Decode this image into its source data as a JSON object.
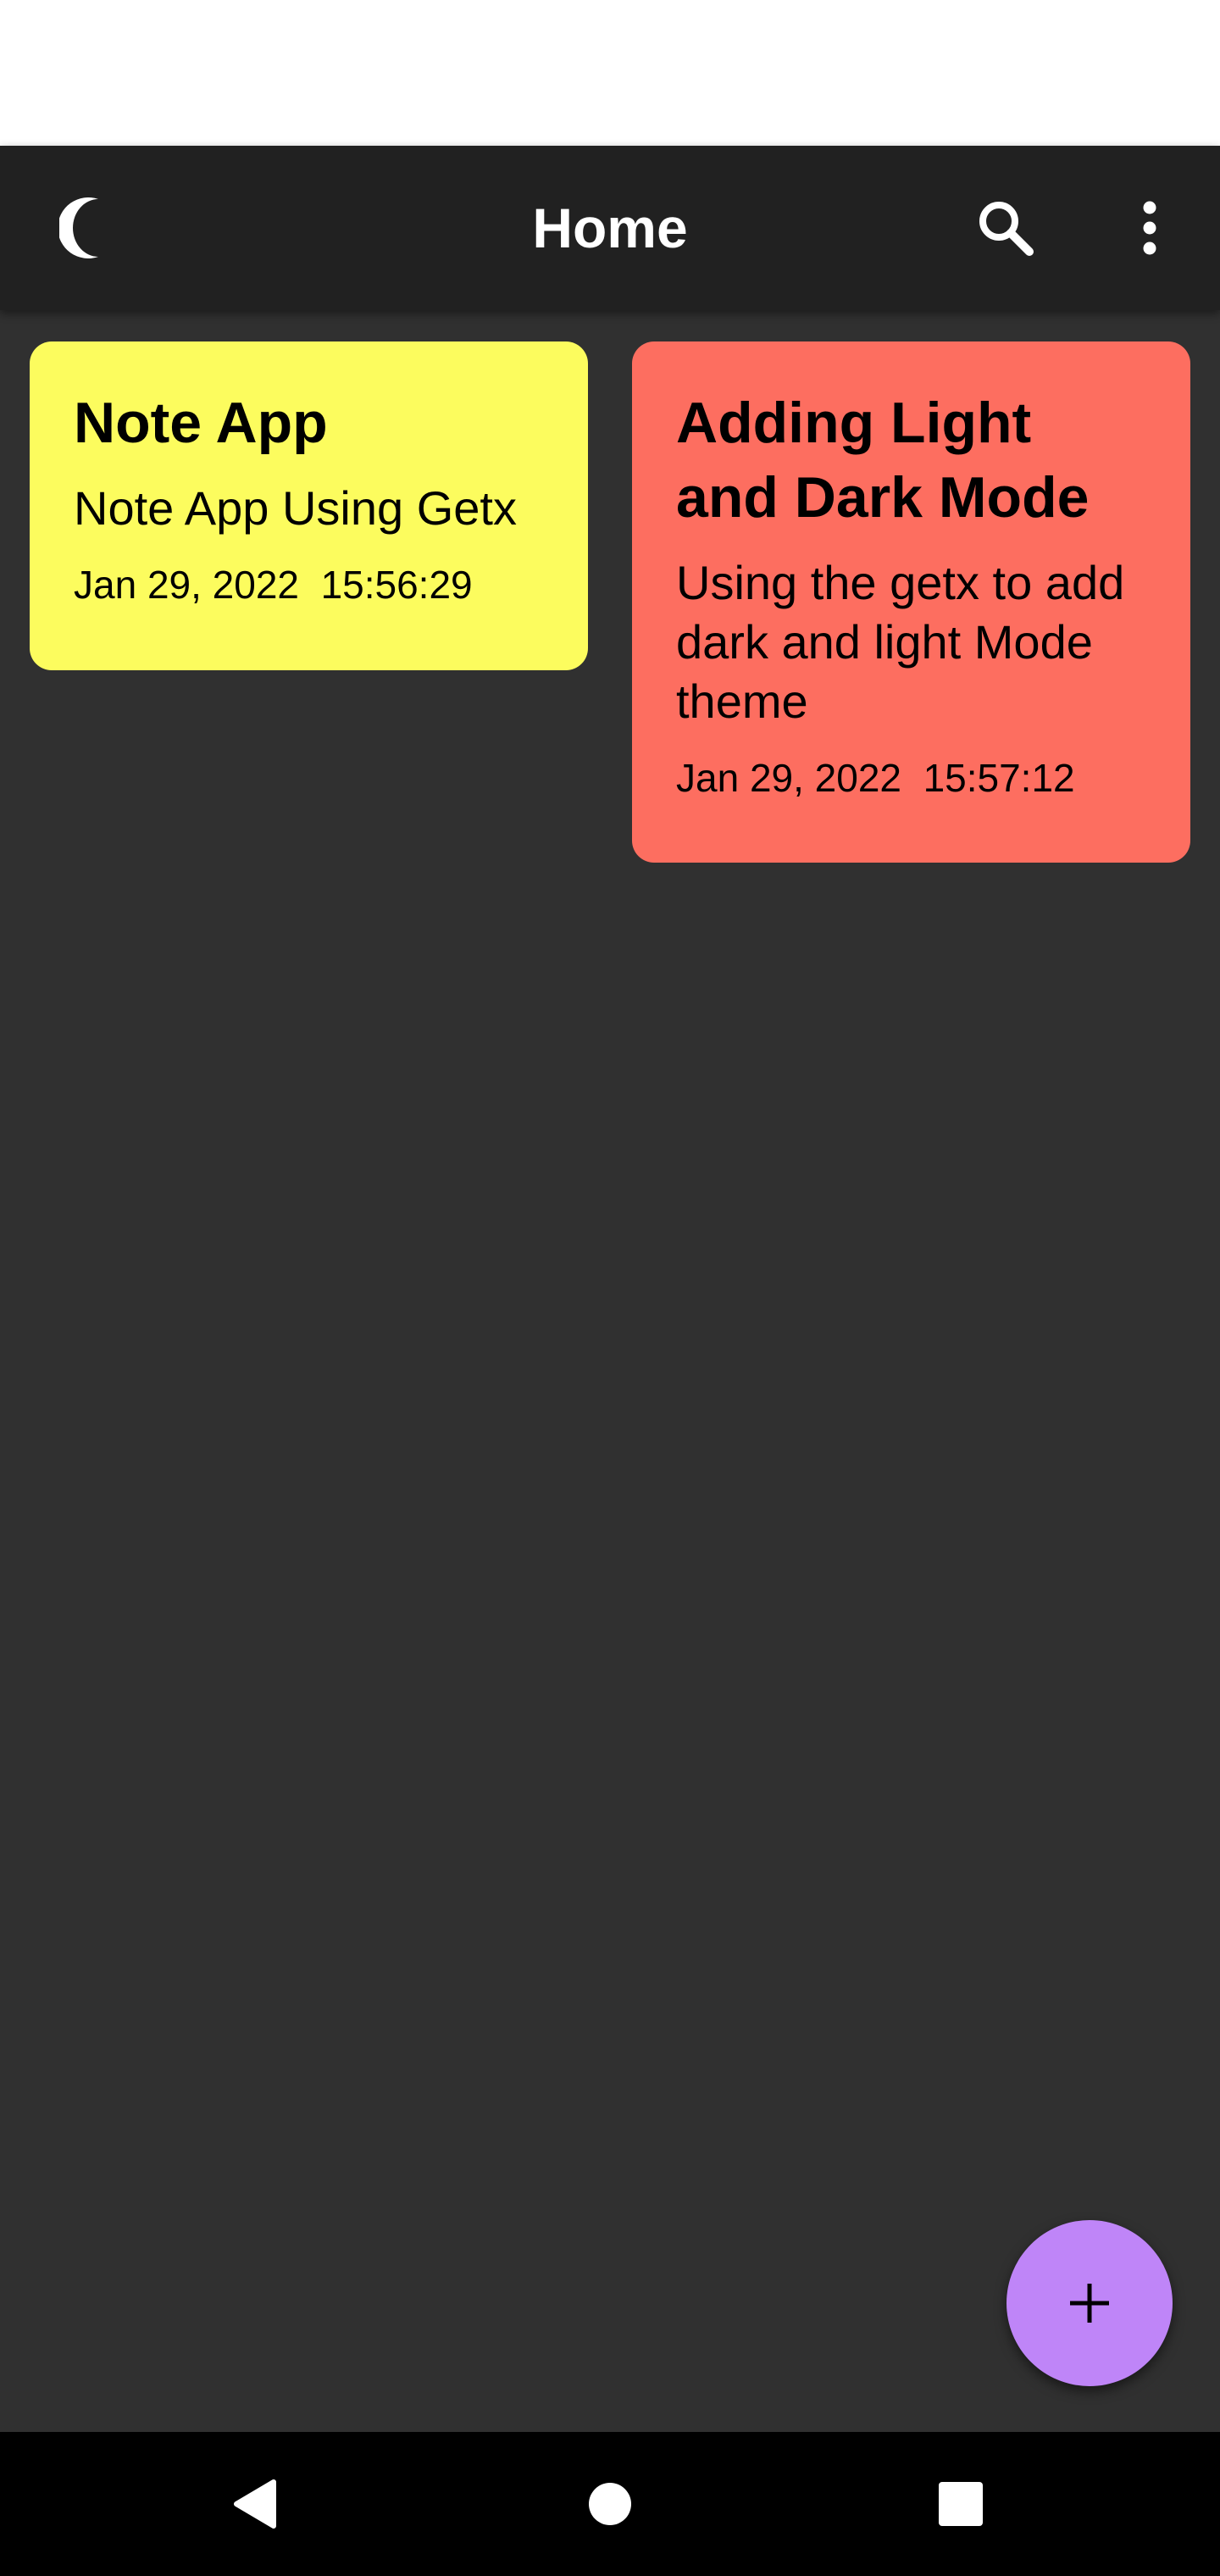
{
  "app_bar": {
    "title": "Home",
    "theme_icon": "moon-icon",
    "search_icon": "search-icon",
    "menu_icon": "more-vert-icon"
  },
  "notes": [
    {
      "title": "Note App",
      "body": "Note App Using Getx",
      "date": "Jan 29, 2022  15:56:29",
      "color": "#fcfc5e"
    },
    {
      "title": "Adding Light and Dark Mode",
      "body": "Using the getx to add dark and light Mode theme",
      "date": "Jan 29, 2022  15:57:12",
      "color": "#fd6e60"
    }
  ],
  "fab": {
    "icon": "plus-icon",
    "color": "#bf85f8"
  },
  "nav_bar": {
    "back_icon": "back-icon",
    "home_icon": "home-icon",
    "recents_icon": "recents-icon"
  },
  "colors": {
    "background": "#303030",
    "app_bar": "#212121"
  }
}
